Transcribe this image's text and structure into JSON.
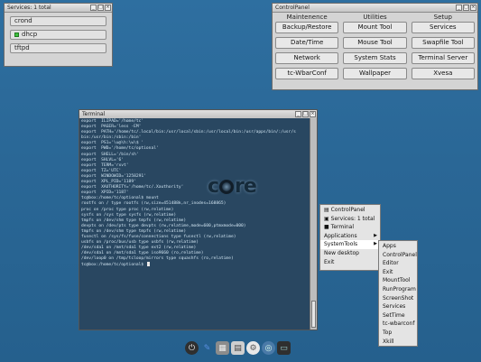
{
  "services_window": {
    "title": "Services: 1 total",
    "items": [
      {
        "label": "crond",
        "running": false
      },
      {
        "label": "dhcp",
        "running": true
      },
      {
        "label": "tftpd",
        "running": false
      }
    ]
  },
  "control_panel": {
    "title": "ControlPanel",
    "columns": [
      {
        "header": "Maintenence",
        "buttons": [
          "Backup/Restore",
          "Date/Time",
          "Network",
          "tc-WbarConf"
        ]
      },
      {
        "header": "Utilities",
        "buttons": [
          "Mount Tool",
          "Mouse Tool",
          "System Stats",
          "Wallpaper"
        ]
      },
      {
        "header": "Setup",
        "buttons": [
          "Services",
          "Swapfile Tool",
          "Terminal Server",
          "Xvesa"
        ]
      }
    ]
  },
  "terminal": {
    "title": "Terminal",
    "lines": [
      "export  ILIPAD='/home/tc'",
      "export  PAGER='less -EM'",
      "export  PATH='/home/tc/.local/bin:/usr/local/sbin:/usr/local/bin:/usr/apps/bin/:/usr/s",
      "bin:/usr/bin:/sbin:/bin'",
      "export  PS1='\\u@\\h:\\w\\$ '",
      "export  PWD='/home/tc/optional'",
      "export  SHELL='/bin/sh'",
      "export  SHLVL='6'",
      "export  TERM='rxvt'",
      "export  TZ='UTC'",
      "export  WINDOWID='1258291'",
      "export  XPL_PID='1189'",
      "export  XAUTHORITY='/home/tc/.Xauthority'",
      "export  XPID='1187'",
      "tc@box:/home/tc/optional$ mount",
      "rootfs on / type rootfs (rw,size=451488k,nr_inodes=168865)",
      "proc on /proc type proc (rw,relatime)",
      "sysfs on /sys type sysfs (rw,relatime)",
      "tmpfs on /dev/shm type tmpfs (rw,relatime)",
      "devpts on /dev/pts type devpts (rw,relatime,mode=600,ptmxmode=000)",
      "tmpfs on /dev/shm type tmpfs (rw,relatime)",
      "fusectl on /sys/fs/fuse/connections type fusectl (rw,relatime)",
      "usbfs on /proc/bus/usb type usbfs (rw,relatime)",
      "/dev/sda1 on /mnt/sda1 type ext2 (rw,relatime)",
      "/dev/sda1 on /mnt/sda1 type iso9660 (ro,relatime)",
      "/dev/loop0 on /tmp/tcloop/mirrors type squashfs (ro,relatime)",
      "tc@box:/home/tc/optional$ "
    ],
    "logo_left": "c",
    "logo_right": "re"
  },
  "root_menu": {
    "items": [
      {
        "label": "ControlPanel",
        "icon": "panel-icon",
        "submenu": false
      },
      {
        "label": "Services: 1 total",
        "icon": "services-icon",
        "submenu": false
      },
      {
        "label": "Terminal",
        "icon": "terminal-icon",
        "submenu": false
      },
      {
        "label": "Applications",
        "icon": "",
        "submenu": true
      },
      {
        "label": "SystemTools",
        "icon": "",
        "submenu": true,
        "selected": true
      },
      {
        "label": "New desktop",
        "icon": "",
        "submenu": false
      },
      {
        "label": "Exit",
        "icon": "",
        "submenu": false
      }
    ]
  },
  "system_tools_menu": {
    "items": [
      "Apps",
      "ControlPanel",
      "Editor",
      "Exit",
      "MountTool",
      "RunProgram",
      "ScreenShot",
      "Services",
      "SetTime",
      "tc-wbarconf",
      "Top",
      "Xkill"
    ]
  },
  "dock": {
    "icons": [
      "power-icon",
      "pen-icon",
      "calendar-icon",
      "files-icon",
      "gear-icon",
      "globe-icon",
      "monitor-icon"
    ],
    "colors": [
      "#333333",
      "#3a6fc8",
      "#7a7a7a",
      "#d8d8d8",
      "#f0f0f0",
      "#4a7aa8",
      "#2f2f2f"
    ]
  }
}
